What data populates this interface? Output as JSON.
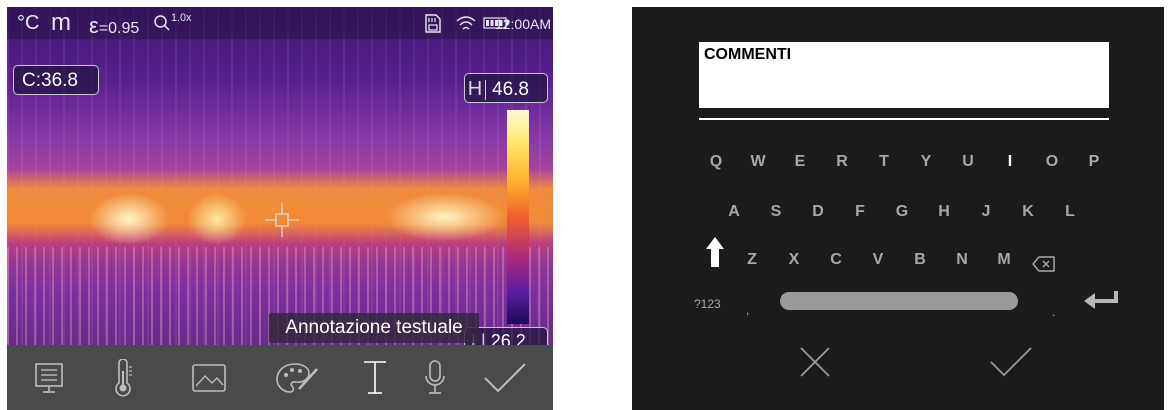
{
  "camera": {
    "status": {
      "temp_unit": "°C",
      "mode": "m",
      "emissivity_symbol": "ε",
      "emissivity": "=0.95",
      "zoom": "1.0x",
      "time": "12:00AM"
    },
    "center_temp": "C:36.8",
    "high_label": "H",
    "high_temp": "46.8",
    "low_temp": "26.2",
    "tooltip": "Annotazione testuale",
    "palette": {
      "hot": "#fffbd8",
      "mid": "#f0602a",
      "cold": "#1a0a58"
    },
    "toolbar": [
      "list-icon",
      "thermometer-icon",
      "image-icon",
      "palette-icon",
      "text-icon",
      "microphone-icon",
      "check-icon"
    ]
  },
  "keyboard": {
    "field_value": "COMMENTI",
    "rows": [
      [
        "Q",
        "W",
        "E",
        "R",
        "T",
        "Y",
        "U",
        "I",
        "O",
        "P"
      ],
      [
        "A",
        "S",
        "D",
        "F",
        "G",
        "H",
        "J",
        "K",
        "L"
      ],
      [
        "Z",
        "X",
        "C",
        "V",
        "B",
        "N",
        "M"
      ]
    ],
    "active_key": "I",
    "numeric_label": "?123",
    "left_punct": ",",
    "right_punct": "."
  }
}
